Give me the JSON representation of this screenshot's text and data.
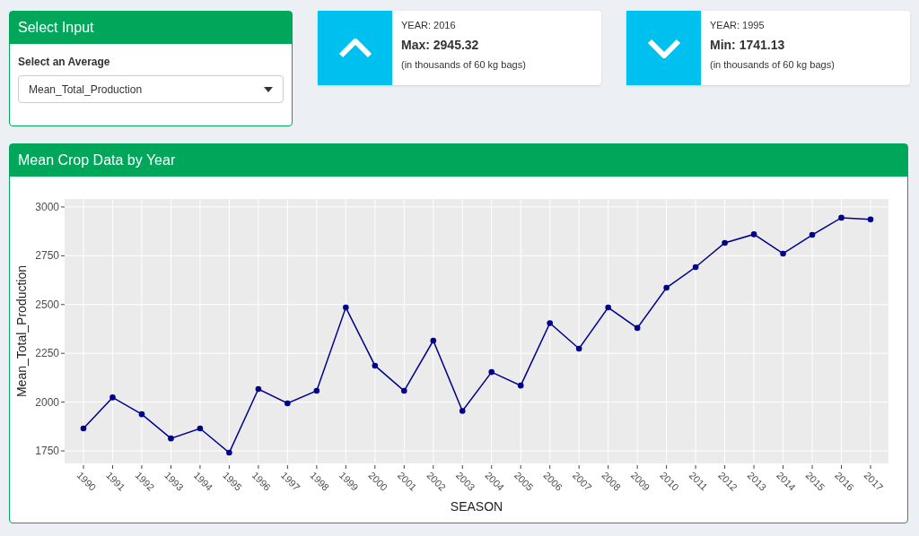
{
  "select_panel": {
    "title": "Select Input",
    "field_label": "Select an Average",
    "dropdown": {
      "value": "Mean_Total_Production"
    }
  },
  "info_boxes": [
    {
      "kind": "max",
      "year_label": "YEAR: 2016",
      "value": "Max: 2945.32",
      "note": "(in thousands of 60 kg bags)"
    },
    {
      "kind": "min",
      "year_label": "YEAR: 1995",
      "value": "Min: 1741.13",
      "note": "(in thousands of 60 kg bags)"
    }
  ],
  "chart_panel": {
    "title": "Mean Crop Data by Year",
    "chart_data": {
      "type": "line",
      "xlabel": "SEASON",
      "ylabel": "Mean_Total_Production",
      "categories": [
        "1990",
        "1991",
        "1992",
        "1993",
        "1994",
        "1995",
        "1996",
        "1997",
        "1998",
        "1999",
        "2000",
        "2001",
        "2002",
        "2003",
        "2004",
        "2005",
        "2006",
        "2007",
        "2008",
        "2009",
        "2010",
        "2011",
        "2012",
        "2013",
        "2014",
        "2015",
        "2016",
        "2017"
      ],
      "series": [
        {
          "color": "#00008b",
          "marker": true,
          "values": [
            1865,
            2024,
            1938,
            1814,
            1865,
            1741,
            2067,
            1994,
            2058,
            2485,
            2187,
            2058,
            2315,
            1955,
            2154,
            2085,
            2405,
            2274,
            2485,
            2380,
            2586,
            2692,
            2816,
            2860,
            2761,
            2857,
            2945,
            2936
          ]
        }
      ],
      "grid": true,
      "ylim": [
        1686,
        3041
      ],
      "yticks": [
        1750,
        2000,
        2250,
        2500,
        2750,
        3000
      ]
    }
  }
}
